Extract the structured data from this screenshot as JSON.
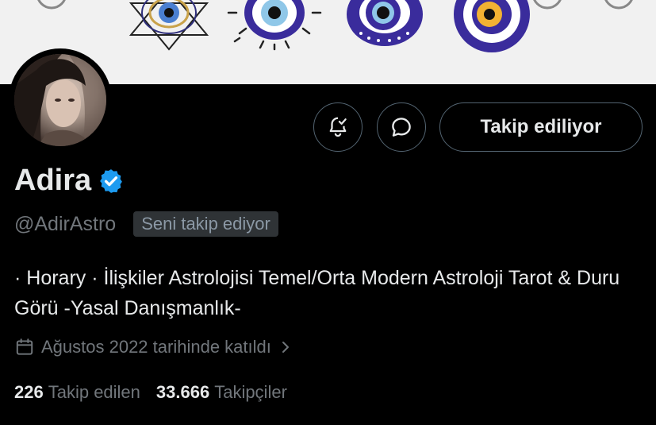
{
  "profile": {
    "name": "Adira",
    "handle": "@AdirAstro",
    "follows_you": "Seni takip ediyor",
    "bio": "· Horary · İlişkiler Astrolojisi Temel/Orta Modern Astroloji Tarot & Duru Görü -Yasal Danışmanlık-",
    "joined": "Ağustos 2022 tarihinde katıldı",
    "following_count": "226",
    "following_label": "Takip edilen",
    "followers_count": "33.666",
    "followers_label": "Takipçiler"
  },
  "actions": {
    "notifications_icon": "bell-check-icon",
    "message_icon": "message-icon",
    "follow_label": "Takip ediliyor"
  },
  "colors": {
    "background": "#000000",
    "text_primary": "#e7e9ea",
    "text_secondary": "#71767b",
    "verified": "#1d9bf0",
    "border": "#536471",
    "banner_bg": "#f1f1f1",
    "evil_eye_blue": "#3a2c9c"
  }
}
